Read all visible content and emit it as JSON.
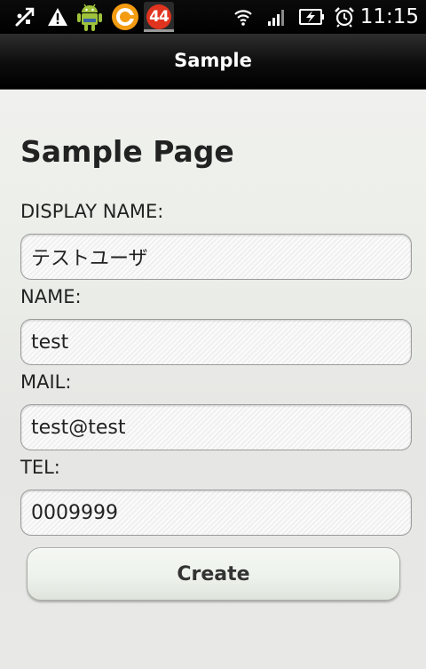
{
  "status_bar": {
    "icons": [
      "usb-debug-icon",
      "warning-icon",
      "android-icon",
      "app-ring-icon"
    ],
    "notification_count": "44",
    "right_icons": [
      "wifi-icon",
      "signal-icon",
      "battery-charging-icon",
      "alarm-clock-icon"
    ],
    "time": "11:15"
  },
  "titlebar": {
    "title": "Sample"
  },
  "page": {
    "heading": "Sample Page"
  },
  "form": {
    "display_name": {
      "label": "DISPLAY NAME:",
      "value": "テストユーザ"
    },
    "name": {
      "label": "NAME:",
      "value": "test"
    },
    "mail": {
      "label": "MAIL:",
      "value": "test@test"
    },
    "tel": {
      "label": "TEL:",
      "value": "0009999"
    },
    "submit_label": "Create"
  },
  "colors": {
    "notification_badge": "#e0341f",
    "app_ring": "#f39c12",
    "android_green": "#9fc33a"
  }
}
